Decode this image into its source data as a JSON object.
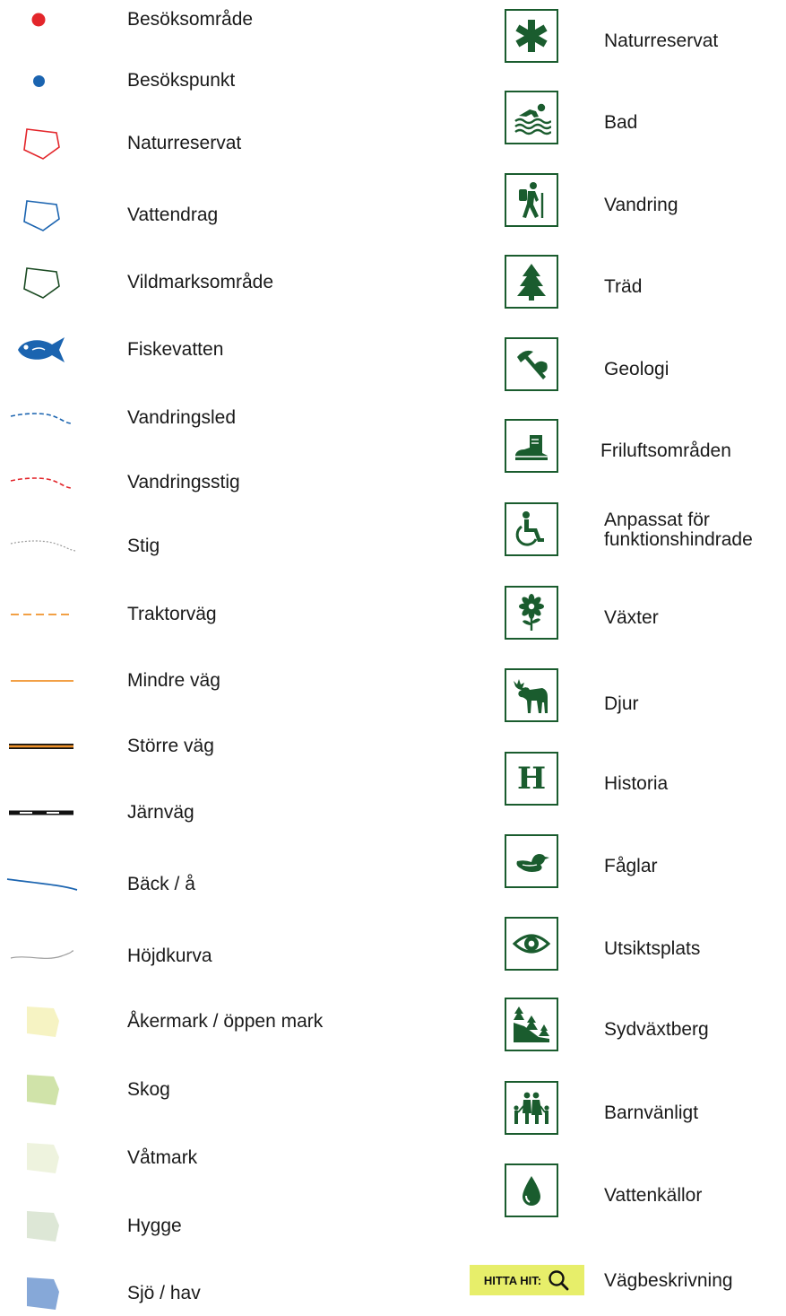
{
  "left_legend": [
    {
      "symbol": "red-dot-icon",
      "label": "Besöksområde",
      "color": "#e3262b"
    },
    {
      "symbol": "blue-dot-icon",
      "label": "Besökspunkt",
      "color": "#1b64b0"
    },
    {
      "symbol": "red-polygon-outline-icon",
      "label": "Naturreservat",
      "color": "#e3262b"
    },
    {
      "symbol": "blue-polygon-outline-icon",
      "label": "Vattendrag",
      "color": "#1b64b0"
    },
    {
      "symbol": "green-polygon-outline-icon",
      "label": "Vildmarksområde",
      "color": "#1a4a22"
    },
    {
      "symbol": "fish-icon",
      "label": "Fiskevatten",
      "color": "#1b64b0"
    },
    {
      "symbol": "blue-dashed-line-icon",
      "label": "Vandringsled",
      "color": "#1b64b0"
    },
    {
      "symbol": "red-dashed-line-icon",
      "label": "Vandringsstig",
      "color": "#e3262b"
    },
    {
      "symbol": "gray-dotted-line-icon",
      "label": "Stig",
      "color": "#9a9a9a"
    },
    {
      "symbol": "orange-dashed-line-icon",
      "label": "Traktorväg",
      "color": "#f0932b"
    },
    {
      "symbol": "orange-line-icon",
      "label": "Mindre väg",
      "color": "#f0932b"
    },
    {
      "symbol": "major-road-line-icon",
      "label": "Större väg",
      "color": "#f0932b"
    },
    {
      "symbol": "railway-line-icon",
      "label": "Järnväg",
      "color": "#111111"
    },
    {
      "symbol": "stream-line-icon",
      "label": "Bäck / å",
      "color": "#1b64b0"
    },
    {
      "symbol": "contour-line-icon",
      "label": "Höjdkurva",
      "color": "#9a9a9a"
    },
    {
      "symbol": "field-area-icon",
      "label": "Åkermark / öppen mark",
      "color": "#f6f3c3"
    },
    {
      "symbol": "forest-area-icon",
      "label": "Skog",
      "color": "#d0e3a9"
    },
    {
      "symbol": "wetland-area-icon",
      "label": "Våtmark",
      "color": "#eef3de"
    },
    {
      "symbol": "clearcut-area-icon",
      "label": "Hygge",
      "color": "#dde7d6"
    },
    {
      "symbol": "water-area-icon",
      "label": "Sjö / hav",
      "color": "#86a8d8"
    }
  ],
  "right_legend": [
    {
      "symbol": "nature-reserve-icon",
      "label": "Naturreservat"
    },
    {
      "symbol": "swimming-icon",
      "label": "Bad"
    },
    {
      "symbol": "hiking-icon",
      "label": "Vandring"
    },
    {
      "symbol": "tree-icon",
      "label": "Träd"
    },
    {
      "symbol": "geology-icon",
      "label": "Geologi"
    },
    {
      "symbol": "boot-icon",
      "label": "Friluftsområden"
    },
    {
      "symbol": "wheelchair-icon",
      "label": "Anpassat för funktionshindrade"
    },
    {
      "symbol": "flower-icon",
      "label": "Växter"
    },
    {
      "symbol": "moose-icon",
      "label": "Djur"
    },
    {
      "symbol": "history-icon",
      "label": "Historia",
      "glyph": "H"
    },
    {
      "symbol": "duck-icon",
      "label": "Fåglar"
    },
    {
      "symbol": "eye-icon",
      "label": "Utsiktsplats"
    },
    {
      "symbol": "south-slope-icon",
      "label": "Sydväxtberg"
    },
    {
      "symbol": "family-icon",
      "label": "Barnvänligt"
    },
    {
      "symbol": "water-drop-icon",
      "label": "Vattenkällor"
    }
  ],
  "find_button": {
    "label": "HITTA HIT:",
    "icon": "magnifier-icon",
    "color": "#e7ee6a",
    "description": "Vägbeskrivning"
  },
  "icon_color": "#1a5c2e"
}
